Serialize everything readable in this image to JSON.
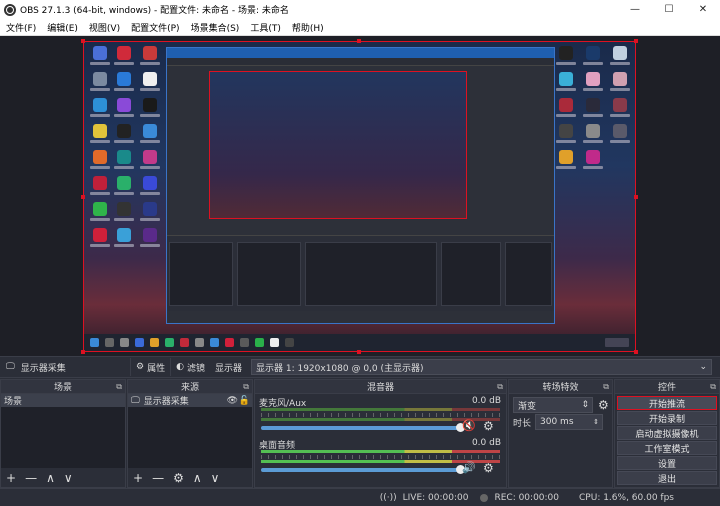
{
  "window": {
    "title": "OBS 27.1.3 (64-bit, windows) - 配置文件: 未命名 - 场景: 未命名",
    "controls": [
      "—",
      "☐",
      "✕"
    ]
  },
  "menu": [
    "文件(F)",
    "编辑(E)",
    "视图(V)",
    "配置文件(P)",
    "场景集合(S)",
    "工具(T)",
    "帮助(H)"
  ],
  "toolbar": {
    "source_name": "显示器采集",
    "properties_label": "属性",
    "filters_label": "滤镜",
    "display_label": "显示器",
    "display_value": "显示器 1: 1920x1080 @ 0,0 (主显示器)"
  },
  "scenes": {
    "header": "场景",
    "items": [
      "场景"
    ]
  },
  "sources": {
    "header": "来源",
    "items": [
      "显示器采集"
    ]
  },
  "mixer": {
    "header": "混音器",
    "tracks": [
      {
        "name": "麦克风/Aux",
        "db": "0.0 dB",
        "muted": true,
        "level": 0.72
      },
      {
        "name": "桌面音频",
        "db": "0.0 dB",
        "muted": false,
        "level": 0.72
      }
    ]
  },
  "transitions": {
    "header": "转场特效",
    "type": "渐变",
    "duration_label": "时长",
    "duration_value": "300 ms"
  },
  "controls": {
    "header": "控件",
    "buttons": [
      "开始推流",
      "开始录制",
      "启动虚拟摄像机",
      "工作室模式",
      "设置",
      "退出"
    ]
  },
  "status": {
    "live": "LIVE: 00:00:00",
    "rec": "REC: 00:00:00",
    "cpu": "CPU: 1.6%, 60.00 fps"
  },
  "colors": {
    "accent_red": "#dd1122",
    "slider_blue": "#5b9bd5",
    "mute_red": "#e0303a"
  }
}
